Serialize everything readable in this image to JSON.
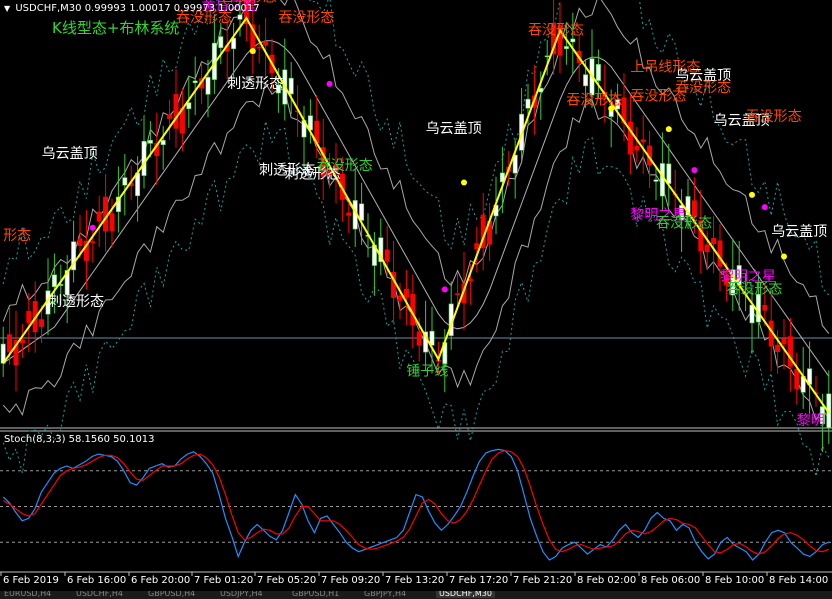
{
  "window": {
    "symbol_title": "USDCHF,M30",
    "prices": "0.99993 1.00017 0.99973 1.00017",
    "subtitle": "K线型态+布林系统",
    "stoch_label": "Stoch(8,3,3) 58.1560 50.1013"
  },
  "tabs": [
    "EURUSD,H4",
    "USDCHF,H4",
    "GBPUSD,H4",
    "USDJPY,H4",
    "GBPUSD,H1",
    "GBPJPY,H4",
    "USDCHF,M30"
  ],
  "active_tab": 6,
  "colors": {
    "bull": "#ffffff",
    "bull_edge": "#32cd32",
    "bear": "#ff0000",
    "bb_mid": "#b0b0b0",
    "bb_inner": "#a8a8a8",
    "bb_outer": "#1ea0a0",
    "zigzag": "#ffff00",
    "stoch_main": "#1e90ff",
    "stoch_signal": "#ff0000",
    "bearish_pattern": "#ff4500",
    "bullish_pattern": "#32cd32",
    "neutral_pattern": "#ffffff",
    "star_pattern": "#ff00ff"
  },
  "chart_data": [
    {
      "type": "candlestick",
      "title": "USDCHF,M30",
      "ylim": [
        0,
        100
      ],
      "x_ticks": [
        "6 Feb 2019",
        "6 Feb 16:00",
        "6 Feb 20:00",
        "7 Feb 01:20",
        "7 Feb 05:20",
        "7 Feb 09:20",
        "7 Feb 13:20",
        "7 Feb 17:20",
        "7 Feb 21:20",
        "8 Feb 02:00",
        "8 Feb 06:00",
        "8 Feb 10:00",
        "8 Feb 14:00"
      ],
      "zigzag": [
        [
          0,
          15
        ],
        [
          38,
          99
        ],
        [
          68,
          16
        ],
        [
          87,
          96
        ],
        [
          129,
          3
        ]
      ],
      "dots": [
        {
          "x": 14,
          "y": 48,
          "color": "#ff00ff"
        },
        {
          "x": 39,
          "y": 91,
          "color": "#ffff00"
        },
        {
          "x": 51,
          "y": 83,
          "color": "#ff00ff"
        },
        {
          "x": 69,
          "y": 33,
          "color": "#ff00ff"
        },
        {
          "x": 72,
          "y": 59,
          "color": "#ffff00"
        },
        {
          "x": 95,
          "y": 77,
          "color": "#ffff00"
        },
        {
          "x": 104,
          "y": 72,
          "color": "#ffff00"
        },
        {
          "x": 108,
          "y": 62,
          "color": "#ff00ff"
        },
        {
          "x": 117,
          "y": 56,
          "color": "#ffff00"
        },
        {
          "x": 119,
          "y": 53,
          "color": "#ff00ff"
        },
        {
          "x": 122,
          "y": 41,
          "color": "#ffff00"
        }
      ],
      "annotations": [
        {
          "text": "形态",
          "x": 0,
          "y": 45,
          "color": "#ff4500"
        },
        {
          "text": "乌云盖顶",
          "x": 6,
          "y": 65,
          "color": "#ffffff"
        },
        {
          "text": "刺透形态",
          "x": 7,
          "y": 29,
          "color": "#ffffff"
        },
        {
          "text": "吞没形态",
          "x": 27,
          "y": 98,
          "color": "#ff4500"
        },
        {
          "text": "黄昏之星",
          "x": 31,
          "y": 101,
          "color": "#ff00ff"
        },
        {
          "text": "吞没形态",
          "x": 34,
          "y": 103,
          "color": "#ff4500"
        },
        {
          "text": "吞没形态",
          "x": 43,
          "y": 98,
          "color": "#ff4500"
        },
        {
          "text": "刺透形态",
          "x": 35,
          "y": 82,
          "color": "#ffffff"
        },
        {
          "text": "刺透形态",
          "x": 40,
          "y": 61,
          "color": "#ffffff"
        },
        {
          "text": "刺透形态",
          "x": 44,
          "y": 60,
          "color": "#ffffff"
        },
        {
          "text": "吞没形态",
          "x": 49,
          "y": 62,
          "color": "#32cd32"
        },
        {
          "text": "乌云盖顶",
          "x": 66,
          "y": 71,
          "color": "#ffffff"
        },
        {
          "text": "锤子线",
          "x": 63,
          "y": 12,
          "color": "#32cd32"
        },
        {
          "text": "吞没形态",
          "x": 82,
          "y": 95,
          "color": "#ff4500"
        },
        {
          "text": "上吊线形态",
          "x": 98,
          "y": 86,
          "color": "#ff4500"
        },
        {
          "text": "吞没形态",
          "x": 98,
          "y": 79,
          "color": "#ff4500"
        },
        {
          "text": "吞没形态",
          "x": 88,
          "y": 78,
          "color": "#ff4500"
        },
        {
          "text": "乌云盖顶",
          "x": 105,
          "y": 84,
          "color": "#ffffff"
        },
        {
          "text": "吞没形态",
          "x": 105,
          "y": 81,
          "color": "#ff4500"
        },
        {
          "text": "乌云盖顶",
          "x": 111,
          "y": 73,
          "color": "#ffffff"
        },
        {
          "text": "吞没形态",
          "x": 116,
          "y": 74,
          "color": "#ff4500"
        },
        {
          "text": "黎明之星",
          "x": 98,
          "y": 50,
          "color": "#ff00ff"
        },
        {
          "text": "吞没形态",
          "x": 102,
          "y": 48,
          "color": "#32cd32"
        },
        {
          "text": "乌云盖顶",
          "x": 120,
          "y": 46,
          "color": "#ffffff"
        },
        {
          "text": "黎明之星",
          "x": 112,
          "y": 35,
          "color": "#ff00ff"
        },
        {
          "text": "吞没形态",
          "x": 113,
          "y": 32,
          "color": "#32cd32"
        },
        {
          "text": "黎明",
          "x": 124,
          "y": 0,
          "color": "#ff00ff"
        }
      ]
    },
    {
      "type": "line",
      "title": "Stoch(8,3,3)",
      "ylim": [
        0,
        100
      ],
      "levels": [
        80,
        50,
        20
      ],
      "series": [
        {
          "name": "Main",
          "values": [
            58,
            53,
            45,
            38,
            40,
            48,
            62,
            70,
            78,
            82,
            84,
            82,
            85,
            88,
            92,
            94,
            93,
            92,
            88,
            80,
            70,
            68,
            74,
            82,
            84,
            86,
            83,
            84,
            90,
            94,
            96,
            92,
            86,
            78,
            60,
            40,
            25,
            8,
            20,
            30,
            35,
            30,
            25,
            22,
            30,
            45,
            60,
            52,
            38,
            28,
            40,
            42,
            35,
            28,
            20,
            15,
            12,
            14,
            16,
            18,
            20,
            22,
            24,
            30,
            45,
            60,
            58,
            46,
            36,
            30,
            35,
            42,
            50,
            62,
            76,
            88,
            95,
            97,
            98,
            97,
            92,
            80,
            60,
            40,
            25,
            12,
            5,
            8,
            15,
            18,
            20,
            15,
            10,
            14,
            18,
            16,
            22,
            30,
            35,
            28,
            24,
            30,
            40,
            45,
            40,
            38,
            30,
            35,
            32,
            20,
            12,
            6,
            10,
            20,
            24,
            18,
            15,
            12,
            5,
            10,
            20,
            28,
            30,
            28,
            20,
            15,
            10,
            8,
            12,
            18,
            20
          ]
        },
        {
          "name": "Signal",
          "values": [
            55,
            52,
            48,
            44,
            42,
            44,
            52,
            60,
            68,
            76,
            80,
            82,
            83,
            85,
            88,
            91,
            93,
            93,
            91,
            86,
            79,
            73,
            72,
            76,
            80,
            84,
            84,
            84,
            86,
            90,
            93,
            94,
            91,
            85,
            75,
            60,
            43,
            28,
            22,
            24,
            28,
            31,
            30,
            27,
            27,
            32,
            42,
            50,
            50,
            44,
            38,
            38,
            38,
            35,
            30,
            24,
            18,
            15,
            14,
            15,
            17,
            19,
            21,
            24,
            31,
            42,
            53,
            56,
            52,
            44,
            38,
            36,
            39,
            46,
            56,
            68,
            80,
            90,
            95,
            97,
            96,
            92,
            82,
            67,
            50,
            35,
            22,
            14,
            12,
            14,
            17,
            18,
            16,
            14,
            15,
            16,
            17,
            21,
            27,
            30,
            29,
            27,
            29,
            33,
            38,
            40,
            39,
            36,
            35,
            32,
            25,
            18,
            12,
            11,
            14,
            18,
            19,
            16,
            12,
            10,
            12,
            17,
            23,
            27,
            28,
            26,
            22,
            17,
            13,
            12,
            14
          ]
        }
      ]
    }
  ]
}
